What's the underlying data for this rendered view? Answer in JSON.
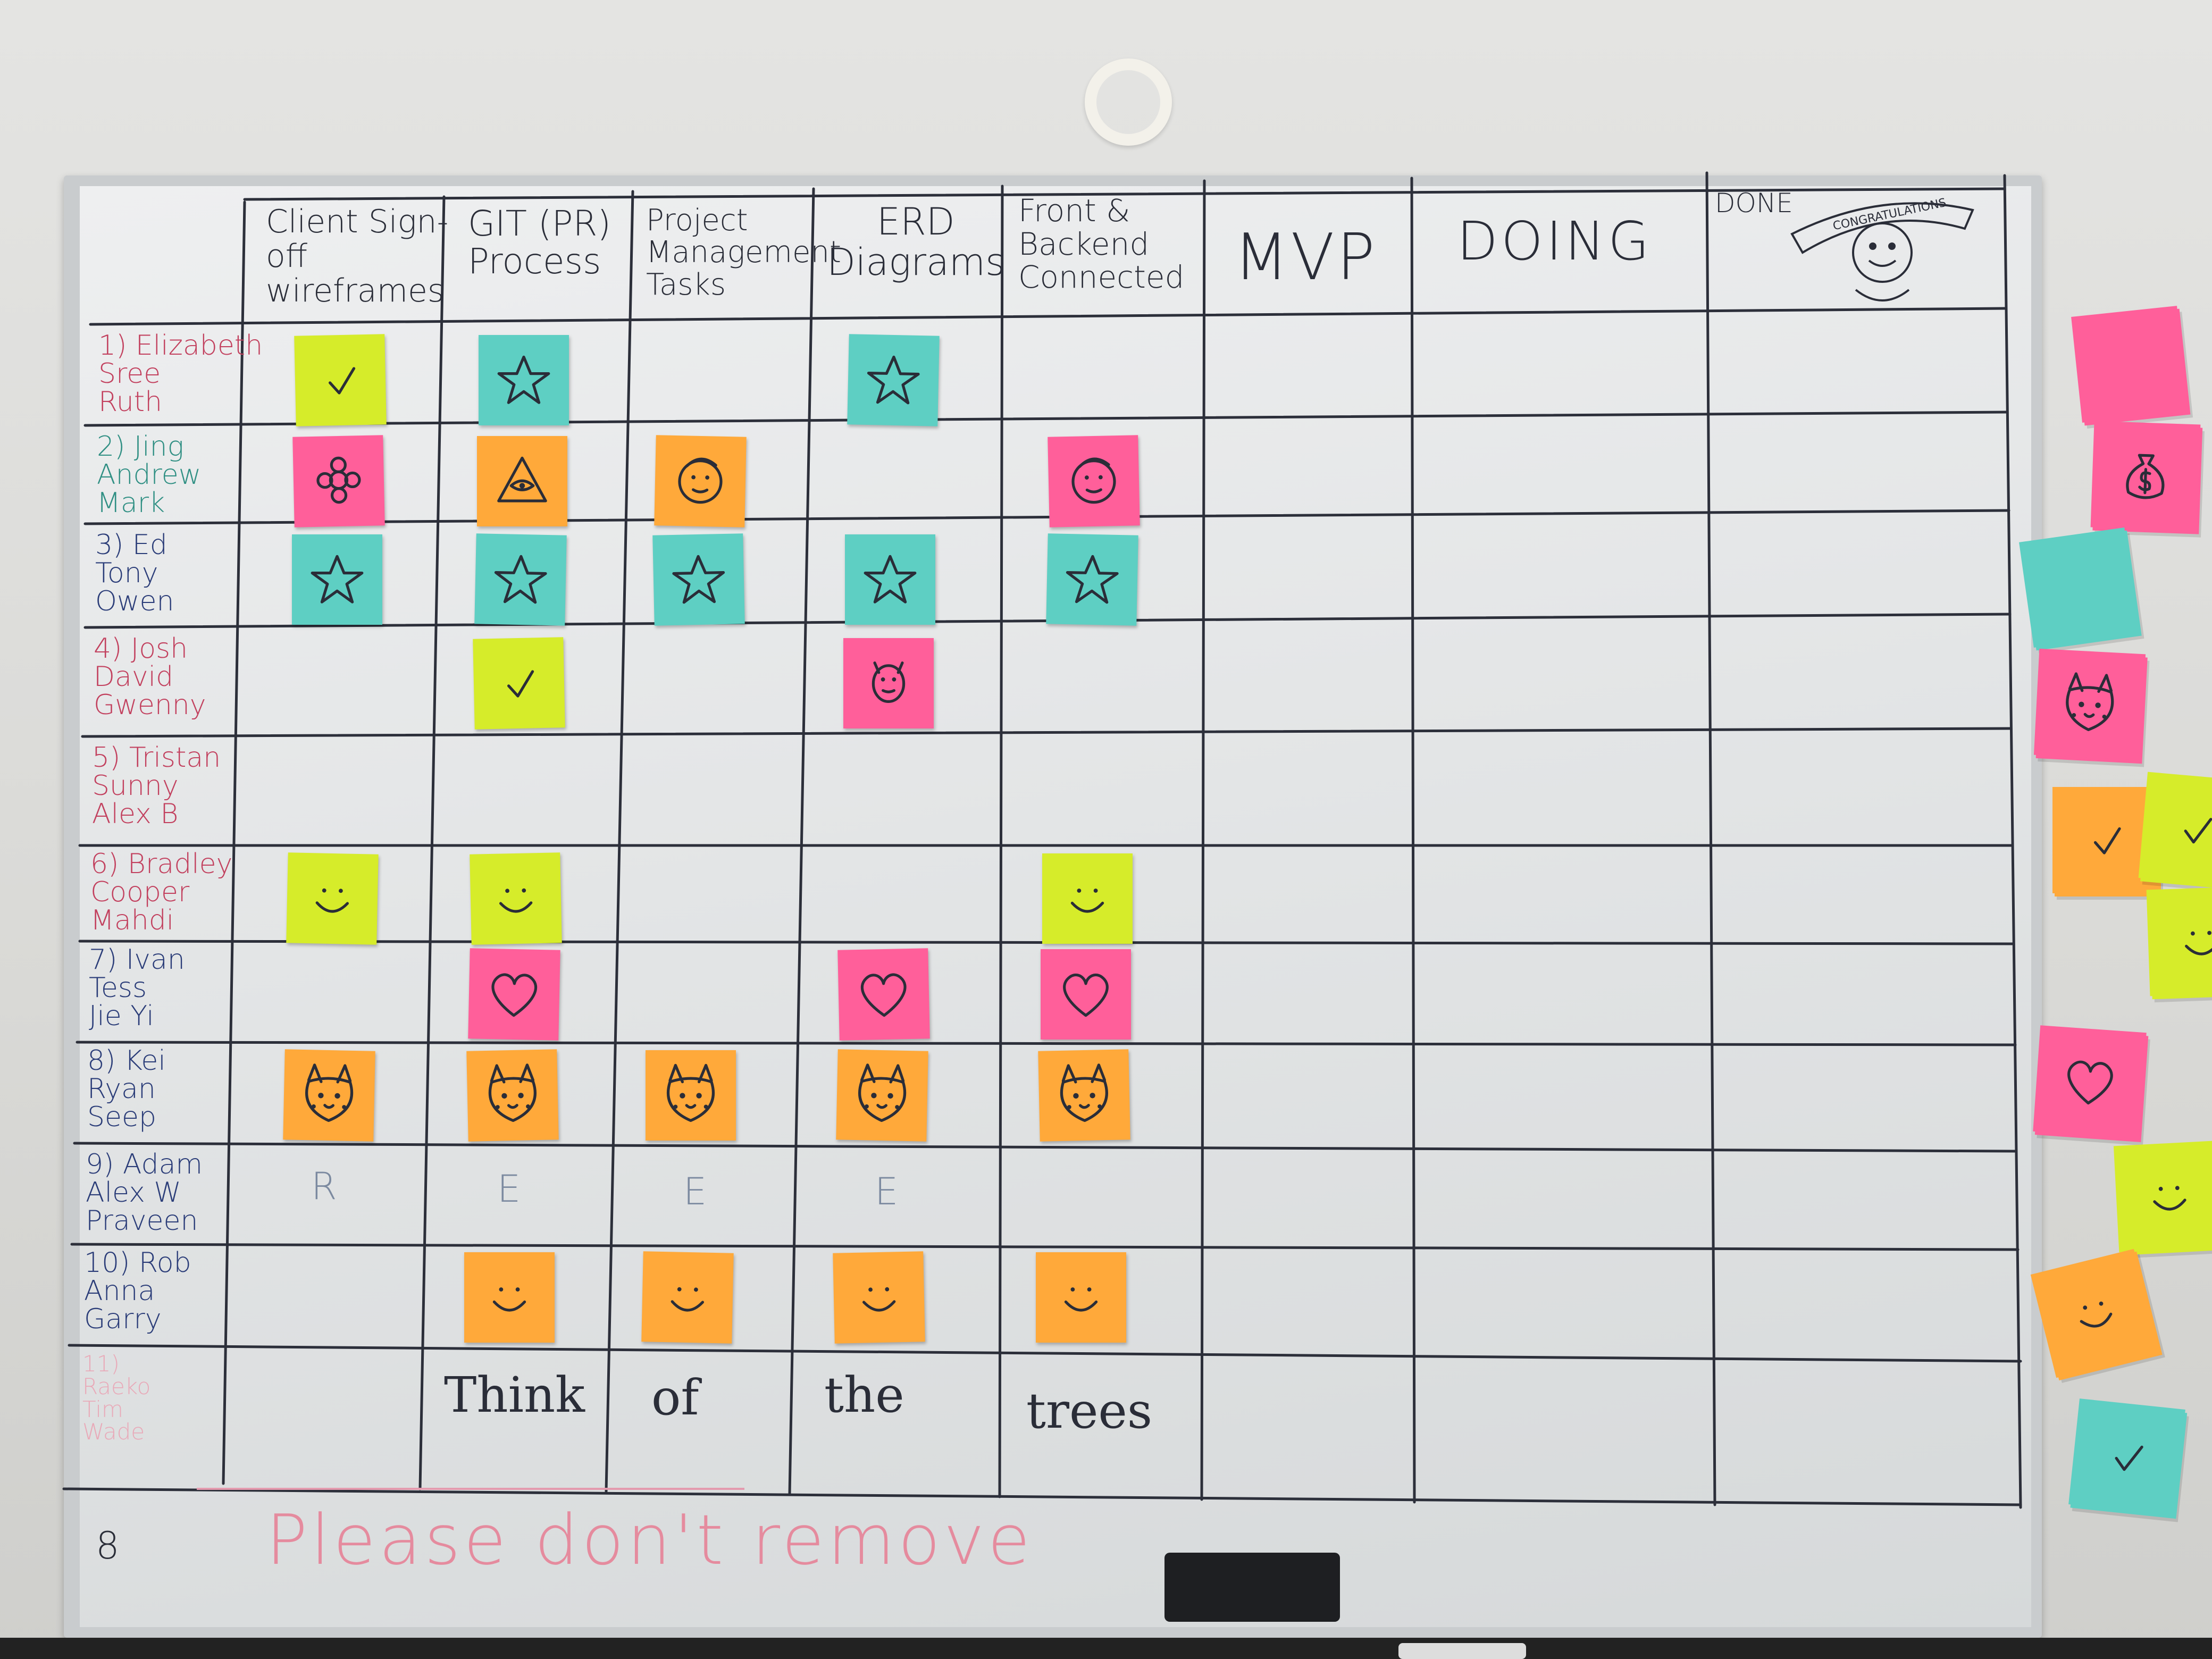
{
  "columns": [
    {
      "id": "c1",
      "label": "Client Sign-\noff\nwireframes"
    },
    {
      "id": "c2",
      "label": "GIT (PR)\nProcess"
    },
    {
      "id": "c3",
      "label": "Project\nManagement\nTasks"
    },
    {
      "id": "c4",
      "label": "ERD\nDiagrams"
    },
    {
      "id": "c5",
      "label": "Front &\nBackend\nConnected"
    },
    {
      "id": "c6",
      "label": "MVP"
    },
    {
      "id": "c7",
      "label": "DOING"
    },
    {
      "id": "c8",
      "label": "DONE"
    }
  ],
  "done_badge": "CONGRATULATIONS",
  "rows": [
    {
      "label": "1) Elizabeth\nSree\nRuth",
      "color": "#c2405e"
    },
    {
      "label": "2) Jing\nAndrew\nMark",
      "color": "#2f8f83"
    },
    {
      "label": "3) Ed\nTony\nOwen",
      "color": "#2a3c78"
    },
    {
      "label": "4) Josh\nDavid\nGwenny",
      "color": "#c2405e"
    },
    {
      "label": "5) Tristan\nSunny\nAlex B",
      "color": "#c2405e"
    },
    {
      "label": "6) Bradley\nCooper\nMahdi",
      "color": "#c2405e"
    },
    {
      "label": "7) Ivan\nTess\nJie Yi",
      "color": "#2a3c78"
    },
    {
      "label": "8) Kei\nRyan\nSeep",
      "color": "#2a3c78"
    },
    {
      "label": "9) Adam\nAlex W\nPraveen",
      "color": "#2a3c78"
    },
    {
      "label": "10) Rob\nAnna\nGarry",
      "color": "#2a3c78"
    },
    {
      "label": "11)\nRaeko\nTim\nWade",
      "color": "#e9a9b8"
    }
  ],
  "row9_letters": [
    "R",
    "E",
    "E",
    "E"
  ],
  "row11_words": [
    "Think",
    "of",
    "the",
    "trees"
  ],
  "footer_note": "Please don't remove",
  "footer_mark": "8",
  "colors": {
    "yellow": "#d6ec2a",
    "teal": "#5ecfc3",
    "orange": "#ffa93a",
    "pink": "#ff5f9a",
    "pen": "#2a2d38"
  },
  "stickies": [
    {
      "row": 1,
      "col": 1,
      "color": "yellow",
      "icon": "check-icon"
    },
    {
      "row": 1,
      "col": 2,
      "color": "teal",
      "icon": "star-icon"
    },
    {
      "row": 1,
      "col": 4,
      "color": "teal",
      "icon": "star-icon"
    },
    {
      "row": 2,
      "col": 1,
      "color": "pink",
      "icon": "flower-doodle-icon"
    },
    {
      "row": 2,
      "col": 2,
      "color": "orange",
      "icon": "eye-pyramid-icon"
    },
    {
      "row": 2,
      "col": 3,
      "color": "orange",
      "icon": "face-doodle-icon"
    },
    {
      "row": 2,
      "col": 5,
      "color": "pink",
      "icon": "face-doodle-icon"
    },
    {
      "row": 3,
      "col": 1,
      "color": "teal",
      "icon": "star-icon"
    },
    {
      "row": 3,
      "col": 2,
      "color": "teal",
      "icon": "star-icon"
    },
    {
      "row": 3,
      "col": 3,
      "color": "teal",
      "icon": "star-icon"
    },
    {
      "row": 3,
      "col": 4,
      "color": "teal",
      "icon": "star-icon"
    },
    {
      "row": 3,
      "col": 5,
      "color": "teal",
      "icon": "star-icon"
    },
    {
      "row": 4,
      "col": 2,
      "color": "yellow",
      "icon": "check-icon"
    },
    {
      "row": 4,
      "col": 4,
      "color": "pink",
      "icon": "devil-doodle-icon"
    },
    {
      "row": 6,
      "col": 1,
      "color": "yellow",
      "icon": "smiley-icon"
    },
    {
      "row": 6,
      "col": 2,
      "color": "yellow",
      "icon": "smiley-icon"
    },
    {
      "row": 6,
      "col": 5,
      "color": "yellow",
      "icon": "smiley-icon"
    },
    {
      "row": 7,
      "col": 2,
      "color": "pink",
      "icon": "heart-icon"
    },
    {
      "row": 7,
      "col": 4,
      "color": "pink",
      "icon": "heart-icon"
    },
    {
      "row": 7,
      "col": 5,
      "color": "pink",
      "icon": "heart-icon"
    },
    {
      "row": 8,
      "col": 1,
      "color": "orange",
      "icon": "pikachu-icon"
    },
    {
      "row": 8,
      "col": 2,
      "color": "orange",
      "icon": "pikachu-icon"
    },
    {
      "row": 8,
      "col": 3,
      "color": "orange",
      "icon": "pikachu-icon"
    },
    {
      "row": 8,
      "col": 4,
      "color": "orange",
      "icon": "pikachu-icon"
    },
    {
      "row": 8,
      "col": 5,
      "color": "orange",
      "icon": "pikachu-icon"
    },
    {
      "row": 10,
      "col": 2,
      "color": "orange",
      "icon": "smiley-icon"
    },
    {
      "row": 10,
      "col": 3,
      "color": "orange",
      "icon": "smiley-icon"
    },
    {
      "row": 10,
      "col": 4,
      "color": "orange",
      "icon": "smiley-icon"
    },
    {
      "row": 10,
      "col": 5,
      "color": "orange",
      "icon": "smiley-icon"
    }
  ],
  "side_stacks": [
    {
      "color": "pink",
      "icon": "blank-icon"
    },
    {
      "color": "pink",
      "icon": "money-bag-icon"
    },
    {
      "color": "teal",
      "icon": "blank-icon"
    },
    {
      "color": "pink",
      "icon": "pikachu-icon"
    },
    {
      "color": "orange",
      "icon": "check-icon"
    },
    {
      "color": "yellow",
      "icon": "check-icon"
    },
    {
      "color": "yellow",
      "icon": "smiley-icon"
    },
    {
      "color": "pink",
      "icon": "heart-icon"
    },
    {
      "color": "yellow",
      "icon": "smiley-icon"
    },
    {
      "color": "orange",
      "icon": "smiley-icon"
    },
    {
      "color": "teal",
      "icon": "check-icon"
    }
  ]
}
